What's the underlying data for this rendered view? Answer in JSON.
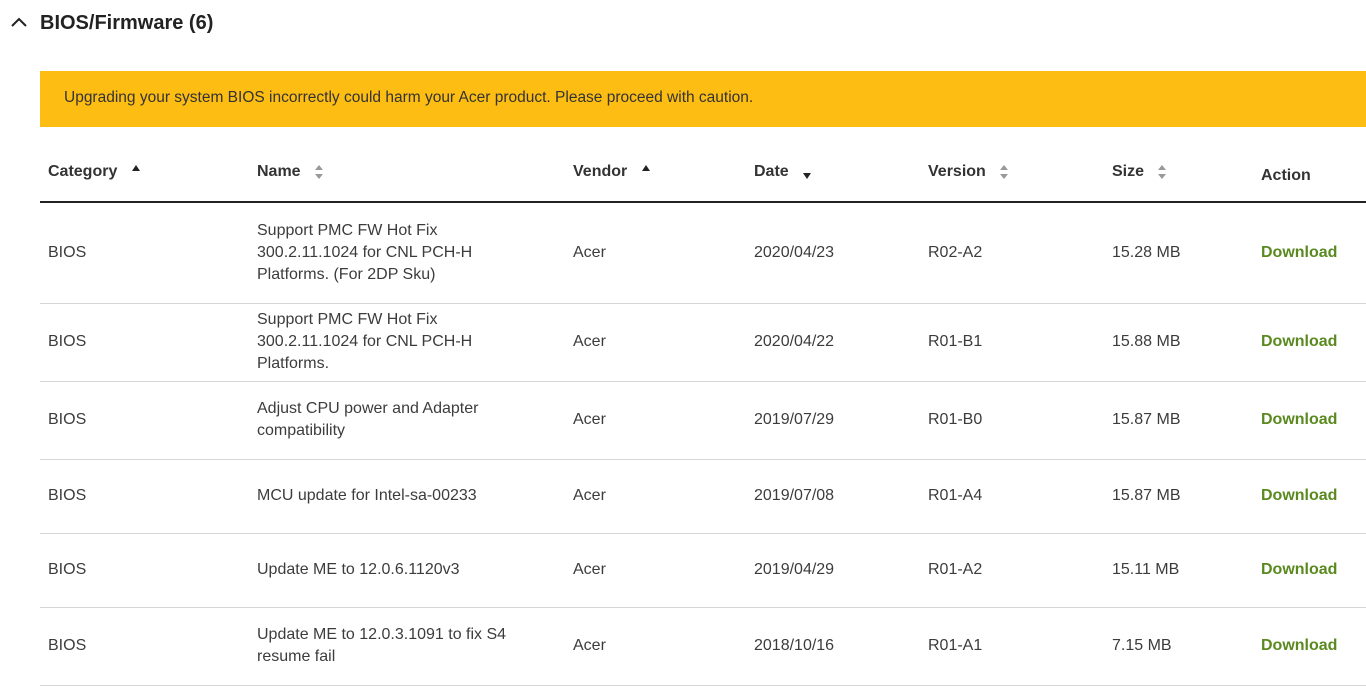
{
  "section": {
    "title": "BIOS/Firmware (6)",
    "chevron_icon": "chevron-up-icon"
  },
  "banner": {
    "text": "Upgrading your system BIOS incorrectly could harm your Acer product. Please proceed with caution.",
    "color": "#fdbd12"
  },
  "table": {
    "headers": {
      "category": "Category",
      "name": "Name",
      "vendor": "Vendor",
      "date": "Date",
      "version": "Version",
      "size": "Size",
      "action": "Action"
    },
    "rows": [
      {
        "category": "BIOS",
        "name": "Support PMC FW Hot Fix 300.2.11.1024 for CNL PCH-H Platforms. (For 2DP Sku)",
        "vendor": "Acer",
        "date": "2020/04/23",
        "version": "R02-A2",
        "size": "15.28 MB",
        "action": "Download"
      },
      {
        "category": "BIOS",
        "name": "Support PMC FW Hot Fix 300.2.11.1024 for CNL PCH-H Platforms.",
        "vendor": "Acer",
        "date": "2020/04/22",
        "version": "R01-B1",
        "size": "15.88 MB",
        "action": "Download"
      },
      {
        "category": "BIOS",
        "name": "Adjust CPU power and Adapter compatibility",
        "vendor": "Acer",
        "date": "2019/07/29",
        "version": "R01-B0",
        "size": "15.87 MB",
        "action": "Download"
      },
      {
        "category": "BIOS",
        "name": "MCU update for Intel-sa-00233",
        "vendor": "Acer",
        "date": "2019/07/08",
        "version": "R01-A4",
        "size": "15.87 MB",
        "action": "Download"
      },
      {
        "category": "BIOS",
        "name": "Update ME to 12.0.6.1120v3",
        "vendor": "Acer",
        "date": "2019/04/29",
        "version": "R01-A2",
        "size": "15.11 MB",
        "action": "Download"
      },
      {
        "category": "BIOS",
        "name": "Update ME to 12.0.3.1091 to fix S4 resume fail",
        "vendor": "Acer",
        "date": "2018/10/16",
        "version": "R01-A1",
        "size": "7.15 MB",
        "action": "Download"
      }
    ]
  },
  "colors": {
    "download_link": "#5a8a1f",
    "banner": "#fdbd12"
  }
}
